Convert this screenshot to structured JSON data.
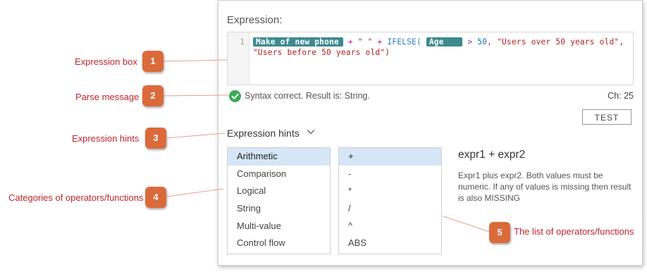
{
  "panel": {
    "title": "Expression:"
  },
  "editor": {
    "line_number": "1",
    "tokens": {
      "field1": "Make of new phone",
      "op1": " + ",
      "str1": "\" \"",
      "op2": " + ",
      "fn1": "IFELSE",
      "paren1": "(",
      "field2": "Age",
      "op3": " > ",
      "num1": "50",
      "comma1": ", ",
      "str2": "\"Users over 50 years old\"",
      "comma2": ",",
      "str3": "\"Users before 50 years old\"",
      "paren2": ")"
    }
  },
  "parse": {
    "message": "Syntax correct. Result is: String.",
    "status_icon": "check-circle-icon",
    "char_count": "Ch:  25"
  },
  "test_button": {
    "label": "TEST"
  },
  "hints": {
    "heading": "Expression hints",
    "categories": [
      "Arithmetic",
      "Comparison",
      "Logical",
      "String",
      "Multi-value",
      "Control flow"
    ],
    "selected_category": "Arithmetic",
    "operators": [
      "+",
      "-",
      "*",
      "/",
      "^",
      "ABS"
    ],
    "selected_operator": "+",
    "help_title": "expr1 + expr2",
    "help_text": "Expr1 plus expr2. Both values must be numeric. If any of values is missing then result is also MISSING"
  },
  "callouts": [
    {
      "number": "1",
      "label": "Expression box"
    },
    {
      "number": "2",
      "label": "Parse message"
    },
    {
      "number": "3",
      "label": "Expression hints"
    },
    {
      "number": "4",
      "label": "Categories of operators/functions"
    },
    {
      "number": "5",
      "label": "The list of operators/functions"
    }
  ],
  "colors": {
    "callout": "#db6a3b",
    "callout_label": "#c0242e",
    "field_token": "#3d8a8f",
    "selection": "#d6e6f7",
    "ok_green": "#3aa857"
  }
}
